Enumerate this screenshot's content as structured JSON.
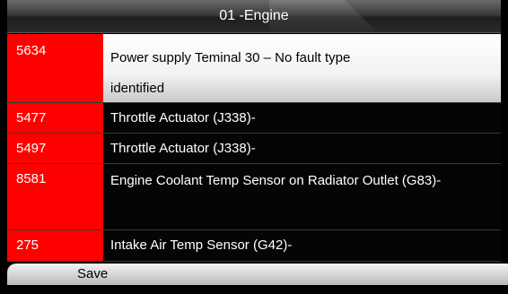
{
  "header": {
    "title": "01  -Engine"
  },
  "fault_list": [
    {
      "code": "5634",
      "desc_line1": "Power supply Teminal 30 – No fault type",
      "desc_line2": "identified",
      "selected": true
    },
    {
      "code": "5477",
      "desc": "Throttle Actuator (J338)-"
    },
    {
      "code": "5497",
      "desc": "Throttle Actuator (J338)-"
    },
    {
      "code": "8581",
      "desc": "Engine Coolant Temp Sensor on Radiator Outlet (G83)-"
    },
    {
      "code": "275",
      "desc": "Intake Air Temp Sensor (G42)-"
    }
  ],
  "footer": {
    "save_label": "Save"
  },
  "colors": {
    "code_background": "#ff0000",
    "row_background": "#050505",
    "selected_row_background": "#ffffff",
    "screen_background": "#000000"
  }
}
